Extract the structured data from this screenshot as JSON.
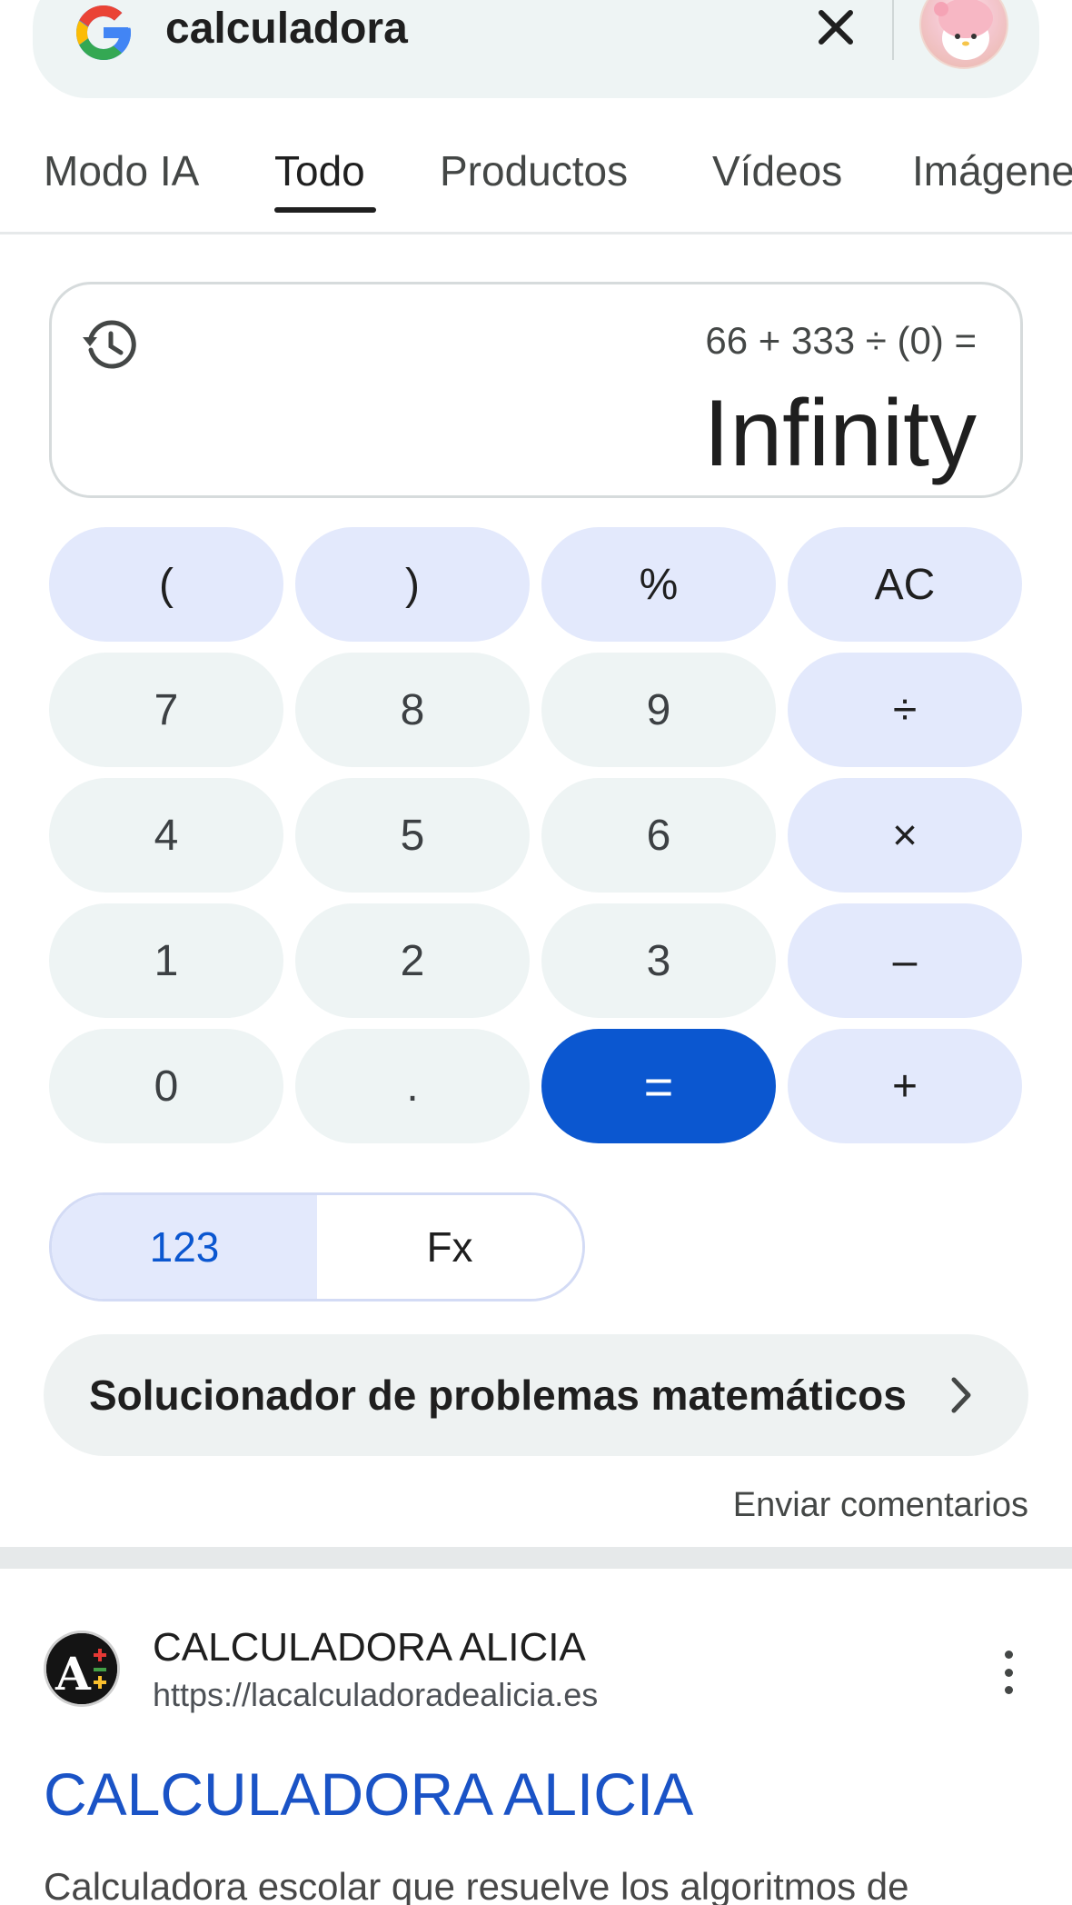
{
  "search": {
    "query": "calculadora",
    "clear_icon": "close-icon",
    "logo": "google-g-logo"
  },
  "tabs": [
    {
      "label": "Modo IA",
      "active": false
    },
    {
      "label": "Todo",
      "active": true
    },
    {
      "label": "Productos",
      "active": false
    },
    {
      "label": "Vídeos",
      "active": false
    },
    {
      "label": "Imágene",
      "active": false
    }
  ],
  "calculator": {
    "expression": "66 + 333 ÷ (0) =",
    "result": "Infinity",
    "history_icon": "history-icon",
    "keys": {
      "row1": [
        "(",
        ")",
        "%",
        "AC"
      ],
      "row2": [
        "7",
        "8",
        "9",
        "÷"
      ],
      "row3": [
        "4",
        "5",
        "6",
        "×"
      ],
      "row4": [
        "1",
        "2",
        "3",
        "–"
      ],
      "row5": [
        "0",
        ".",
        "=",
        "+"
      ]
    },
    "modes": {
      "basic": "123",
      "functions": "Fx",
      "active": "123"
    },
    "colors": {
      "operator_key": "#e3e9fc",
      "number_key": "#eef4f4",
      "equals_key": "#0b57d0"
    }
  },
  "solver": {
    "label": "Solucionador de problemas matemáticos"
  },
  "feedback": {
    "label": "Enviar comentarios"
  },
  "result_card": {
    "site_name": "CALCULADORA ALICIA",
    "url": "https://lacalculadoradealicia.es",
    "title": "CALCULADORA ALICIA",
    "snippet": "Calculadora escolar que resuelve los algoritmos de"
  }
}
